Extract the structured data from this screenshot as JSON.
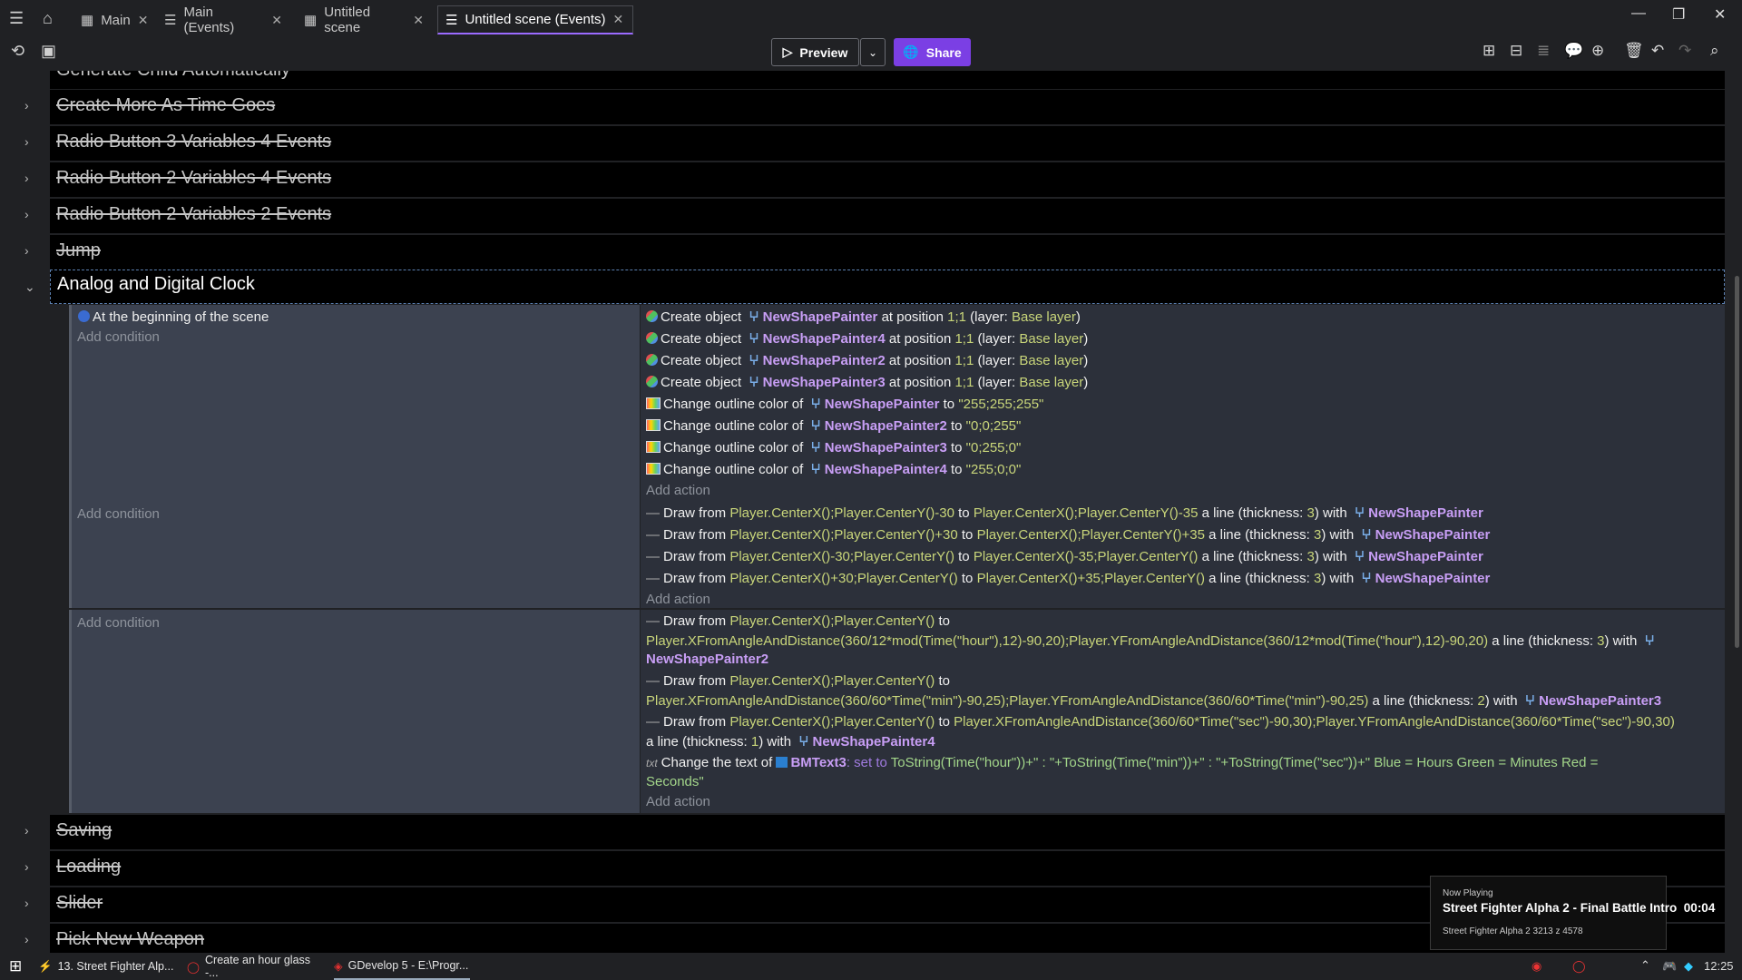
{
  "tabs": [
    {
      "label": "Main",
      "active": false
    },
    {
      "label": "Main (Events)",
      "active": false
    },
    {
      "label": "Untitled scene",
      "active": false
    },
    {
      "label": "Untitled scene (Events)",
      "active": true
    }
  ],
  "toolbar": {
    "preview_label": "Preview",
    "share_label": "Share"
  },
  "groups_top": [
    "Generate Child Automatically",
    "Create More As Time Goes",
    "Radio Button 3 Variables 4 Events",
    "Radio Button 2 Variables 4 Events",
    "Radio Button 2 Variables 2 Events",
    "Jump"
  ],
  "open_group": "Analog and Digital Clock",
  "add_condition": "Add condition",
  "add_action": "Add action",
  "event1": {
    "condition": "At the beginning of the scene",
    "actions": [
      {
        "pre": "Create object",
        "obj": "NewShapePainter",
        "mid": "at position",
        "val": "1;1",
        "post": "(layer:",
        "layer": "Base layer",
        "end": ")"
      },
      {
        "pre": "Create object",
        "obj": "NewShapePainter4",
        "mid": "at position",
        "val": "1;1",
        "post": "(layer:",
        "layer": "Base layer",
        "end": ")"
      },
      {
        "pre": "Create object",
        "obj": "NewShapePainter2",
        "mid": "at position",
        "val": "1;1",
        "post": "(layer:",
        "layer": "Base layer",
        "end": ")"
      },
      {
        "pre": "Create object",
        "obj": "NewShapePainter3",
        "mid": "at position",
        "val": "1;1",
        "post": "(layer:",
        "layer": "Base layer",
        "end": ")"
      }
    ],
    "color_actions": [
      {
        "pre": "Change outline color of",
        "obj": "NewShapePainter",
        "mid": "to",
        "val": "\"255;255;255\""
      },
      {
        "pre": "Change outline color of",
        "obj": "NewShapePainter2",
        "mid": "to",
        "val": "\"0;0;255\""
      },
      {
        "pre": "Change outline color of",
        "obj": "NewShapePainter3",
        "mid": "to",
        "val": "\"0;255;0\""
      },
      {
        "pre": "Change outline color of",
        "obj": "NewShapePainter4",
        "mid": "to",
        "val": "\"255;0;0\""
      }
    ]
  },
  "event2": {
    "actions": [
      {
        "from": "Player.CenterX();Player.CenterY()-30",
        "to": "Player.CenterX();Player.CenterY()-35",
        "thick": "3",
        "obj": "NewShapePainter"
      },
      {
        "from": "Player.CenterX();Player.CenterY()+30",
        "to": "Player.CenterX();Player.CenterY()+35",
        "thick": "3",
        "obj": "NewShapePainter"
      },
      {
        "from": "Player.CenterX()-30;Player.CenterY()",
        "to": "Player.CenterX()-35;Player.CenterY()",
        "thick": "3",
        "obj": "NewShapePainter"
      },
      {
        "from": "Player.CenterX()+30;Player.CenterY()",
        "to": "Player.CenterX()+35;Player.CenterY()",
        "thick": "3",
        "obj": "NewShapePainter"
      }
    ]
  },
  "event3": {
    "a1_from": "Player.CenterX();Player.CenterY()",
    "a1_to": "Player.XFromAngleAndDistance(360/12*mod(Time(\"hour\"),12)-90,20);Player.YFromAngleAndDistance(360/12*mod(Time(\"hour\"),12)-90,20)",
    "a1_thick": "3",
    "a1_obj": "NewShapePainter2",
    "a2_from": "Player.CenterX();Player.CenterY()",
    "a2_to": "Player.XFromAngleAndDistance(360/60*Time(\"min\")-90,25);Player.YFromAngleAndDistance(360/60*Time(\"min\")-90,25)",
    "a2_thick": "2",
    "a2_obj": "NewShapePainter3",
    "a3_from": "Player.CenterX();Player.CenterY()",
    "a3_to": "Player.XFromAngleAndDistance(360/60*Time(\"sec\")-90,30);Player.YFromAngleAndDistance(360/60*Time(\"sec\")-90,30)",
    "a3_thick": "1",
    "a3_obj": "NewShapePainter4",
    "text_pre": "Change the text of",
    "text_obj": "BMText3",
    "text_op": ": set to",
    "text_val1": "ToString(Time(\"hour\"))+\" : \"+ToString(Time(\"min\"))+\" : \"+ToString(Time(\"sec\"))+\" Blue = Hours Green = Minutes Red =",
    "text_val2": "Seconds\""
  },
  "words": {
    "draw_from": "Draw from",
    "to": "to",
    "line_thickness": "a line (thickness:",
    "with": ") with"
  },
  "groups_bottom": [
    "Saving",
    "Loading",
    "Slider",
    "Pick New Weapon"
  ],
  "now_playing": {
    "header": "Now Playing",
    "title": "Street Fighter Alpha 2 - Final Battle Intro",
    "time": "00:04",
    "sub": "Street Fighter Alpha 2 3213 z 4578"
  },
  "taskbar": {
    "apps": [
      "13. Street Fighter Alp...",
      "Create an hour glass -...",
      "GDevelop 5 - E:\\Progr..."
    ],
    "clock": "12:25"
  },
  "colors": {
    "accent": "#7b3fe4",
    "object": "#c89ef5",
    "value": "#c9d67a",
    "cond_bg": "#3c4250",
    "action_bg": "#2c303a"
  }
}
